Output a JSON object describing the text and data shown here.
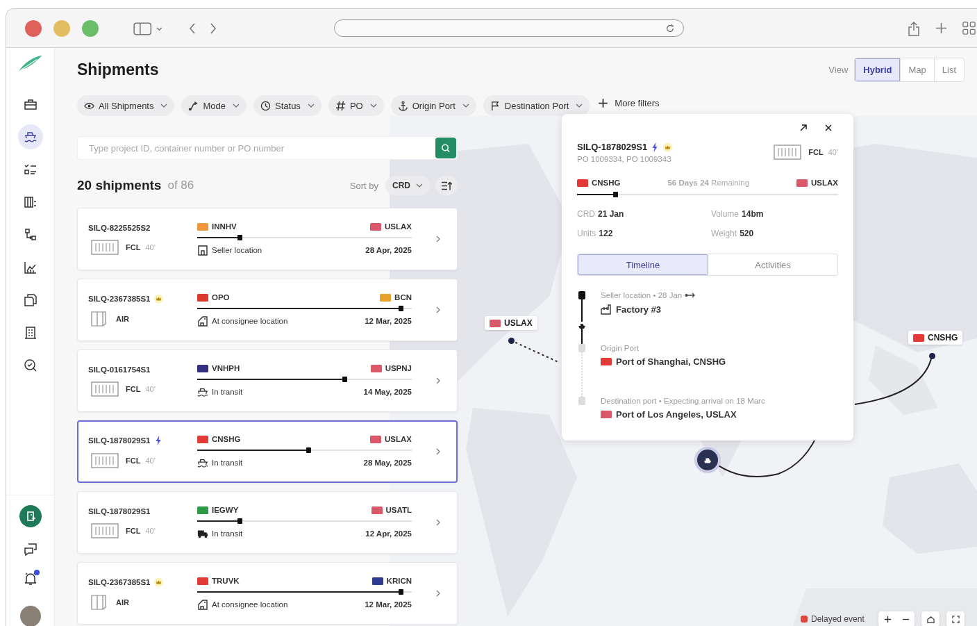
{
  "nav": [
    {
      "selected": false
    },
    {
      "selected": true
    },
    {
      "selected": false
    },
    {
      "selected": false
    },
    {
      "selected": false
    },
    {
      "selected": false
    },
    {
      "selected": false
    },
    {
      "selected": false
    },
    {
      "selected": false
    }
  ],
  "notifications": {
    "unread": true
  },
  "title": "Shipments",
  "view": {
    "label": "View",
    "options": [
      {
        "label": "Hybrid",
        "selected": true
      },
      {
        "label": "Map",
        "selected": false
      },
      {
        "label": "List",
        "selected": false
      }
    ]
  },
  "filters": [
    {
      "label": "All Shipments",
      "kind": "dropdown"
    },
    {
      "label": "Mode",
      "kind": "dropdown"
    },
    {
      "label": "Status",
      "kind": "dropdown"
    },
    {
      "label": "PO",
      "kind": "dropdown"
    },
    {
      "label": "Origin Port",
      "kind": "dropdown"
    },
    {
      "label": "Destination Port",
      "kind": "dropdown"
    },
    {
      "label": "More filters",
      "kind": "add"
    }
  ],
  "search": {
    "placeholder": "Type project ID, container number or PO number"
  },
  "summary": {
    "count": "20 shipments",
    "total": "of 86",
    "sort_label": "Sort by",
    "sort_value": "CRD"
  },
  "shipments": [
    {
      "id": "SILQ-8225525S2",
      "express": false,
      "vip": false,
      "mode": {
        "kind": "fcl",
        "label": "FCL",
        "size": "40'"
      },
      "origin": {
        "code": "INNHV",
        "color": "#f0973a"
      },
      "destination": {
        "code": "USLAX",
        "color": "#d9596b"
      },
      "level": 0.2,
      "status": {
        "kind": "seller",
        "label": "Seller location"
      },
      "date": "28 Apr, 2025",
      "selected": false
    },
    {
      "id": "SILQ-2367385S1",
      "express": false,
      "vip": true,
      "mode": {
        "kind": "air",
        "label": "AIR"
      },
      "origin": {
        "code": "OPO",
        "color": "#d8392c"
      },
      "destination": {
        "code": "BCN",
        "color": "#e8a22c"
      },
      "level": 0.95,
      "status": {
        "kind": "consignee",
        "label": "At consignee location"
      },
      "date": "12 Mar, 2025",
      "selected": false
    },
    {
      "id": "SILQ-0161754S1",
      "express": false,
      "vip": false,
      "mode": {
        "kind": "fcl",
        "label": "FCL",
        "size": "40'"
      },
      "origin": {
        "code": "VNHPH",
        "color": "#34307f"
      },
      "destination": {
        "code": "USPNJ",
        "color": "#d9596b"
      },
      "level": 0.69,
      "status": {
        "kind": "ship",
        "label": "In transit"
      },
      "date": "14 May, 2025",
      "selected": false
    },
    {
      "id": "SILQ-1878029S1",
      "express": true,
      "vip": false,
      "mode": {
        "kind": "fcl",
        "label": "FCL",
        "size": "40'"
      },
      "origin": {
        "code": "CNSHG",
        "color": "#e23a36"
      },
      "destination": {
        "code": "USLAX",
        "color": "#d9596b"
      },
      "level": 0.52,
      "status": {
        "kind": "ship",
        "label": "In transit"
      },
      "date": "28 May, 2025",
      "selected": true
    },
    {
      "id": "SILQ-1878029S1",
      "express": false,
      "vip": false,
      "mode": {
        "kind": "fcl",
        "label": "FCL",
        "size": "40'"
      },
      "origin": {
        "code": "IEGWY",
        "color": "#2f9a46"
      },
      "destination": {
        "code": "USATL",
        "color": "#d9596b"
      },
      "level": 0.2,
      "status": {
        "kind": "truck",
        "label": "In transit"
      },
      "date": "12 Apr, 2025",
      "selected": false
    },
    {
      "id": "SILQ-2367385S1",
      "express": false,
      "vip": true,
      "mode": {
        "kind": "air",
        "label": "AIR"
      },
      "origin": {
        "code": "TRUVK",
        "color": "#e23a36"
      },
      "destination": {
        "code": "KRICN",
        "color": "#2d3b8e"
      },
      "level": 0.95,
      "status": {
        "kind": "consignee",
        "label": "At consignee location"
      },
      "date": "12 Mar, 2025",
      "selected": false
    }
  ],
  "detail": {
    "id": "SILQ-1878029S1",
    "express": true,
    "vip": true,
    "pos": "PO 1009334, PO 1009343",
    "mode": {
      "kind": "fcl",
      "label": "FCL",
      "size": "40'"
    },
    "origin": {
      "code": "CNSHG",
      "color": "#e23a36"
    },
    "remaining": "**56 Days 24** Remaining",
    "destination": {
      "code": "USLAX",
      "color": "#d9596b"
    },
    "level": 0.15,
    "stats": [
      {
        "label": "CRD",
        "value": "21 Jan"
      },
      {
        "label": "Volume",
        "value": "14bm"
      },
      {
        "label": "Units",
        "value": "122"
      },
      {
        "label": "Weight",
        "value": "520"
      }
    ],
    "tabs": [
      {
        "label": "Timeline",
        "selected": true
      },
      {
        "label": "Activities",
        "selected": false
      }
    ],
    "events": [
      {
        "kind": "seller",
        "meta": "Seller location • 28 Jan",
        "title": "Factory #3",
        "done": true,
        "current": true
      },
      {
        "kind": "port",
        "meta": "Origin Port",
        "title": "Port of Shanghai, CNSHG",
        "color": "#e23a36",
        "done": false,
        "current": false
      },
      {
        "kind": "port",
        "meta": "Destination port • Expecting arrival on 18 Marc",
        "title": "Port of Los Angeles, USLAX",
        "color": "#d9596b",
        "done": false,
        "current": false
      }
    ]
  },
  "map": {
    "pins": [
      {
        "code": "USLAX",
        "color": "#d9596b"
      },
      {
        "code": "CNSHG",
        "color": "#e23a36"
      }
    ],
    "legend": {
      "label": "Delayed event",
      "color": "#e0453c"
    }
  }
}
